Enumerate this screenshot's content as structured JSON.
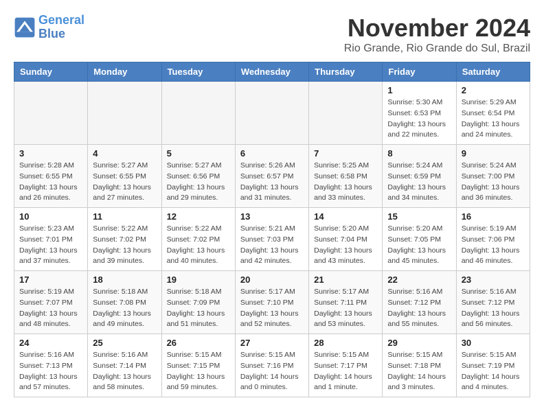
{
  "header": {
    "logo_line1": "General",
    "logo_line2": "Blue",
    "month_title": "November 2024",
    "location": "Rio Grande, Rio Grande do Sul, Brazil"
  },
  "weekdays": [
    "Sunday",
    "Monday",
    "Tuesday",
    "Wednesday",
    "Thursday",
    "Friday",
    "Saturday"
  ],
  "weeks": [
    [
      {
        "day": "",
        "info": ""
      },
      {
        "day": "",
        "info": ""
      },
      {
        "day": "",
        "info": ""
      },
      {
        "day": "",
        "info": ""
      },
      {
        "day": "",
        "info": ""
      },
      {
        "day": "1",
        "info": "Sunrise: 5:30 AM\nSunset: 6:53 PM\nDaylight: 13 hours\nand 22 minutes."
      },
      {
        "day": "2",
        "info": "Sunrise: 5:29 AM\nSunset: 6:54 PM\nDaylight: 13 hours\nand 24 minutes."
      }
    ],
    [
      {
        "day": "3",
        "info": "Sunrise: 5:28 AM\nSunset: 6:55 PM\nDaylight: 13 hours\nand 26 minutes."
      },
      {
        "day": "4",
        "info": "Sunrise: 5:27 AM\nSunset: 6:55 PM\nDaylight: 13 hours\nand 27 minutes."
      },
      {
        "day": "5",
        "info": "Sunrise: 5:27 AM\nSunset: 6:56 PM\nDaylight: 13 hours\nand 29 minutes."
      },
      {
        "day": "6",
        "info": "Sunrise: 5:26 AM\nSunset: 6:57 PM\nDaylight: 13 hours\nand 31 minutes."
      },
      {
        "day": "7",
        "info": "Sunrise: 5:25 AM\nSunset: 6:58 PM\nDaylight: 13 hours\nand 33 minutes."
      },
      {
        "day": "8",
        "info": "Sunrise: 5:24 AM\nSunset: 6:59 PM\nDaylight: 13 hours\nand 34 minutes."
      },
      {
        "day": "9",
        "info": "Sunrise: 5:24 AM\nSunset: 7:00 PM\nDaylight: 13 hours\nand 36 minutes."
      }
    ],
    [
      {
        "day": "10",
        "info": "Sunrise: 5:23 AM\nSunset: 7:01 PM\nDaylight: 13 hours\nand 37 minutes."
      },
      {
        "day": "11",
        "info": "Sunrise: 5:22 AM\nSunset: 7:02 PM\nDaylight: 13 hours\nand 39 minutes."
      },
      {
        "day": "12",
        "info": "Sunrise: 5:22 AM\nSunset: 7:02 PM\nDaylight: 13 hours\nand 40 minutes."
      },
      {
        "day": "13",
        "info": "Sunrise: 5:21 AM\nSunset: 7:03 PM\nDaylight: 13 hours\nand 42 minutes."
      },
      {
        "day": "14",
        "info": "Sunrise: 5:20 AM\nSunset: 7:04 PM\nDaylight: 13 hours\nand 43 minutes."
      },
      {
        "day": "15",
        "info": "Sunrise: 5:20 AM\nSunset: 7:05 PM\nDaylight: 13 hours\nand 45 minutes."
      },
      {
        "day": "16",
        "info": "Sunrise: 5:19 AM\nSunset: 7:06 PM\nDaylight: 13 hours\nand 46 minutes."
      }
    ],
    [
      {
        "day": "17",
        "info": "Sunrise: 5:19 AM\nSunset: 7:07 PM\nDaylight: 13 hours\nand 48 minutes."
      },
      {
        "day": "18",
        "info": "Sunrise: 5:18 AM\nSunset: 7:08 PM\nDaylight: 13 hours\nand 49 minutes."
      },
      {
        "day": "19",
        "info": "Sunrise: 5:18 AM\nSunset: 7:09 PM\nDaylight: 13 hours\nand 51 minutes."
      },
      {
        "day": "20",
        "info": "Sunrise: 5:17 AM\nSunset: 7:10 PM\nDaylight: 13 hours\nand 52 minutes."
      },
      {
        "day": "21",
        "info": "Sunrise: 5:17 AM\nSunset: 7:11 PM\nDaylight: 13 hours\nand 53 minutes."
      },
      {
        "day": "22",
        "info": "Sunrise: 5:16 AM\nSunset: 7:12 PM\nDaylight: 13 hours\nand 55 minutes."
      },
      {
        "day": "23",
        "info": "Sunrise: 5:16 AM\nSunset: 7:12 PM\nDaylight: 13 hours\nand 56 minutes."
      }
    ],
    [
      {
        "day": "24",
        "info": "Sunrise: 5:16 AM\nSunset: 7:13 PM\nDaylight: 13 hours\nand 57 minutes."
      },
      {
        "day": "25",
        "info": "Sunrise: 5:16 AM\nSunset: 7:14 PM\nDaylight: 13 hours\nand 58 minutes."
      },
      {
        "day": "26",
        "info": "Sunrise: 5:15 AM\nSunset: 7:15 PM\nDaylight: 13 hours\nand 59 minutes."
      },
      {
        "day": "27",
        "info": "Sunrise: 5:15 AM\nSunset: 7:16 PM\nDaylight: 14 hours\nand 0 minutes."
      },
      {
        "day": "28",
        "info": "Sunrise: 5:15 AM\nSunset: 7:17 PM\nDaylight: 14 hours\nand 1 minute."
      },
      {
        "day": "29",
        "info": "Sunrise: 5:15 AM\nSunset: 7:18 PM\nDaylight: 14 hours\nand 3 minutes."
      },
      {
        "day": "30",
        "info": "Sunrise: 5:15 AM\nSunset: 7:19 PM\nDaylight: 14 hours\nand 4 minutes."
      }
    ]
  ]
}
